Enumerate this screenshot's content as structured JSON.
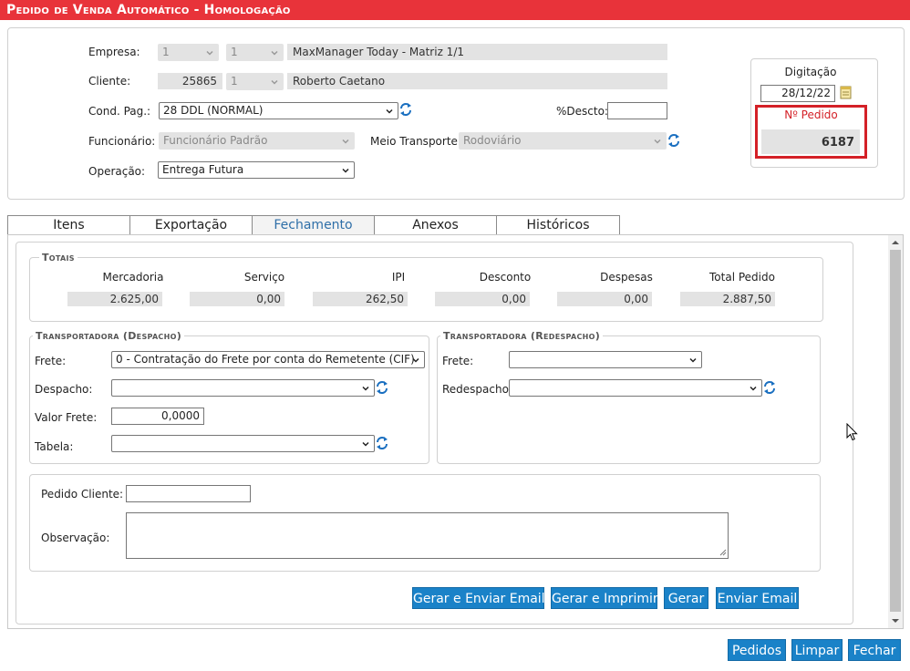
{
  "header": {
    "title": "Pedido de Venda Automático  - Homologação"
  },
  "form": {
    "empresa": {
      "label": "Empresa:",
      "code1": "1",
      "code2": "1",
      "name": "MaxManager Today - Matriz 1/1"
    },
    "cliente": {
      "label": "Cliente:",
      "code": "25865",
      "code2": "1",
      "name": "Roberto Caetano"
    },
    "cond_pag": {
      "label": "Cond. Pag.:",
      "value": "28 DDL (NORMAL)"
    },
    "desconto": {
      "label": "%Descto:",
      "value": ""
    },
    "funcionario": {
      "label": "Funcionário:",
      "value": "Funcionário Padrão"
    },
    "meio_transporte": {
      "label": "Meio Transporte:",
      "value": "Rodoviário"
    },
    "operacao": {
      "label": "Operação:",
      "value": "Entrega Futura"
    }
  },
  "digitacao": {
    "label": "Digitação",
    "date": "28/12/22",
    "pedido_label": "Nº Pedido",
    "pedido_num": "6187"
  },
  "tabs": [
    "Itens",
    "Exportação",
    "Fechamento",
    "Anexos",
    "Históricos"
  ],
  "totais": {
    "legend": "Totais",
    "headers": [
      "Mercadoria",
      "Serviço",
      "IPI",
      "Desconto",
      "Despesas",
      "Total Pedido"
    ],
    "values": [
      "2.625,00",
      "0,00",
      "262,50",
      "0,00",
      "0,00",
      "2.887,50"
    ]
  },
  "despacho": {
    "legend": "Transportadora (Despacho)",
    "frete_label": "Frete:",
    "frete_value": "0 - Contratação do Frete por conta do Remetente (CIF)",
    "despacho_label": "Despacho:",
    "despacho_value": "",
    "valor_label": "Valor Frete:",
    "valor_value": "0,0000",
    "tabela_label": "Tabela:",
    "tabela_value": ""
  },
  "redespacho": {
    "legend": "Transportadora (Redespacho)",
    "frete_label": "Frete:",
    "frete_value": "",
    "redespacho_label": "Redespacho:",
    "redespacho_value": ""
  },
  "extra": {
    "pedido_cliente_label": "Pedido Cliente:",
    "pedido_cliente_value": "",
    "observacao_label": "Observação:",
    "observacao_value": ""
  },
  "actions": [
    "Gerar e Enviar Email",
    "Gerar e Imprimir",
    "Gerar",
    "Enviar Email"
  ],
  "footer": [
    "Pedidos",
    "Limpar",
    "Fechar"
  ],
  "colors": {
    "titlebar": "#e8333a",
    "button": "#1a82c8",
    "highlight": "#d42027",
    "active_tab": "#2f6fa8"
  }
}
